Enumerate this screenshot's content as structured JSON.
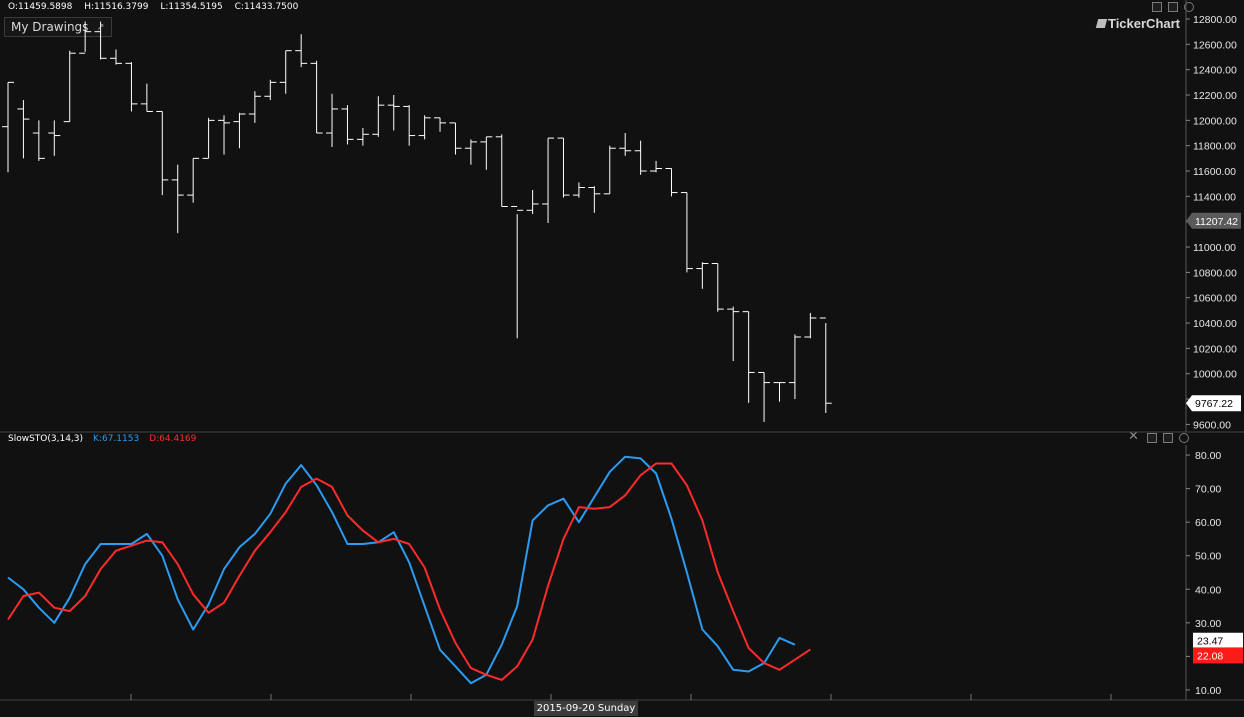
{
  "header": {
    "open": "O:11459.5898",
    "high": "H:11516.3799",
    "low": "L:11354.5195",
    "close": "C:11433.7500",
    "my_drawings": "My Drawings",
    "brand": "TickerChart"
  },
  "indicator_header": {
    "name": "SlowSTO(3,14,3)",
    "k": "K:67.1153",
    "d": "D:64.4169"
  },
  "date_tag": "2015-09-20 Sunday",
  "colors": {
    "background": "#111111",
    "bars": "#ffffff",
    "k_line": "#2b9cf2",
    "d_line": "#ff2b2b",
    "grid_divider": "#444444"
  },
  "chart_data": [
    {
      "type": "ohlc",
      "title": "",
      "price_axis_ticks": [
        "12800.00",
        "12600.00",
        "12400.00",
        "12200.00",
        "12000.00",
        "11800.00",
        "11600.00",
        "11400.00",
        "11200.00",
        "11000.00",
        "10800.00",
        "10600.00",
        "10400.00",
        "10200.00",
        "10000.00",
        "9800.00",
        "9600.00"
      ],
      "ylim": [
        9540,
        12950
      ],
      "last_price_tags": [
        {
          "label": "11207.42",
          "value": 11207.42,
          "style": "grey"
        },
        {
          "label": "9767.22",
          "value": 9767.22,
          "style": "white"
        }
      ],
      "bars": [
        {
          "o": 11950,
          "h": 12300,
          "l": 11590,
          "c": 12300
        },
        {
          "o": 12090,
          "h": 12160,
          "l": 11700,
          "c": 12010
        },
        {
          "o": 11900,
          "h": 12000,
          "l": 11680,
          "c": 11700
        },
        {
          "o": 11900,
          "h": 12000,
          "l": 11720,
          "c": 11880
        },
        {
          "o": 11990,
          "h": 12550,
          "l": 11990,
          "c": 12530
        },
        {
          "o": 12530,
          "h": 12780,
          "l": 12540,
          "c": 12700
        },
        {
          "o": 12700,
          "h": 12780,
          "l": 12480,
          "c": 12490
        },
        {
          "o": 12490,
          "h": 12560,
          "l": 12440,
          "c": 12450
        },
        {
          "o": 12450,
          "h": 12460,
          "l": 12070,
          "c": 12130
        },
        {
          "o": 12130,
          "h": 12290,
          "l": 12070,
          "c": 12070
        },
        {
          "o": 12070,
          "h": 12070,
          "l": 11410,
          "c": 11530
        },
        {
          "o": 11530,
          "h": 11650,
          "l": 11110,
          "c": 11410
        },
        {
          "o": 11410,
          "h": 11700,
          "l": 11350,
          "c": 11700
        },
        {
          "o": 11700,
          "h": 12020,
          "l": 11700,
          "c": 12000
        },
        {
          "o": 12000,
          "h": 12040,
          "l": 11730,
          "c": 11980
        },
        {
          "o": 11990,
          "h": 12060,
          "l": 11780,
          "c": 12050
        },
        {
          "o": 12050,
          "h": 12230,
          "l": 11980,
          "c": 12190
        },
        {
          "o": 12190,
          "h": 12320,
          "l": 12160,
          "c": 12300
        },
        {
          "o": 12300,
          "h": 12550,
          "l": 12210,
          "c": 12550
        },
        {
          "o": 12550,
          "h": 12680,
          "l": 12420,
          "c": 12450
        },
        {
          "o": 12450,
          "h": 12470,
          "l": 11900,
          "c": 11900
        },
        {
          "o": 11900,
          "h": 12210,
          "l": 11790,
          "c": 12090
        },
        {
          "o": 12090,
          "h": 12120,
          "l": 11810,
          "c": 11850
        },
        {
          "o": 11850,
          "h": 11940,
          "l": 11800,
          "c": 11890
        },
        {
          "o": 11890,
          "h": 12190,
          "l": 11870,
          "c": 12120
        },
        {
          "o": 12120,
          "h": 12200,
          "l": 11920,
          "c": 12110
        },
        {
          "o": 12110,
          "h": 12120,
          "l": 11800,
          "c": 11880
        },
        {
          "o": 11880,
          "h": 12040,
          "l": 11850,
          "c": 12020
        },
        {
          "o": 12020,
          "h": 12020,
          "l": 11910,
          "c": 11980
        },
        {
          "o": 11980,
          "h": 11980,
          "l": 11730,
          "c": 11780
        },
        {
          "o": 11780,
          "h": 11850,
          "l": 11650,
          "c": 11830
        },
        {
          "o": 11830,
          "h": 11870,
          "l": 11610,
          "c": 11870
        },
        {
          "o": 11870,
          "h": 11890,
          "l": 11320,
          "c": 11320
        },
        {
          "o": 11320,
          "h": 11260,
          "l": 10280,
          "c": 11290
        },
        {
          "o": 11290,
          "h": 11450,
          "l": 11260,
          "c": 11340
        },
        {
          "o": 11340,
          "h": 11860,
          "l": 11190,
          "c": 11860
        },
        {
          "o": 11860,
          "h": 11860,
          "l": 11390,
          "c": 11410
        },
        {
          "o": 11410,
          "h": 11510,
          "l": 11390,
          "c": 11470
        },
        {
          "o": 11470,
          "h": 11480,
          "l": 11270,
          "c": 11420
        },
        {
          "o": 11420,
          "h": 11800,
          "l": 11420,
          "c": 11780
        },
        {
          "o": 11780,
          "h": 11900,
          "l": 11720,
          "c": 11760
        },
        {
          "o": 11760,
          "h": 11840,
          "l": 11570,
          "c": 11600
        },
        {
          "o": 11600,
          "h": 11680,
          "l": 11590,
          "c": 11620
        },
        {
          "o": 11620,
          "h": 11620,
          "l": 11400,
          "c": 11430
        },
        {
          "o": 11430,
          "h": 11430,
          "l": 10800,
          "c": 10830
        },
        {
          "o": 10830,
          "h": 10880,
          "l": 10670,
          "c": 10870
        },
        {
          "o": 10870,
          "h": 10870,
          "l": 10490,
          "c": 10510
        },
        {
          "o": 10510,
          "h": 10530,
          "l": 10100,
          "c": 10490
        },
        {
          "o": 10490,
          "h": 10490,
          "l": 9770,
          "c": 10010
        },
        {
          "o": 10010,
          "h": 10010,
          "l": 9620,
          "c": 9930
        },
        {
          "o": 9930,
          "h": 9930,
          "l": 9780,
          "c": 9930
        },
        {
          "o": 9930,
          "h": 10310,
          "l": 9800,
          "c": 10290
        },
        {
          "o": 10290,
          "h": 10480,
          "l": 10280,
          "c": 10440
        },
        {
          "o": 10440,
          "h": 10400,
          "l": 9690,
          "c": 9767.22
        }
      ]
    },
    {
      "type": "line",
      "title": "SlowSTO(3,14,3)",
      "y_axis_ticks": [
        "80.00",
        "70.00",
        "60.00",
        "50.00",
        "40.00",
        "30.00",
        "20.00",
        "10.00"
      ],
      "ylim": [
        7,
        83
      ],
      "x_count": 54,
      "last_value_tags": [
        {
          "label": "23.47",
          "value": 23.47,
          "series": "K"
        },
        {
          "label": "22.08",
          "value": 22.08,
          "series": "D"
        }
      ],
      "series": [
        {
          "name": "K",
          "color": "#2b9cf2",
          "x_start": 0,
          "values": [
            43.5,
            40,
            34.5,
            30,
            37.5,
            47.5,
            53.5,
            53.5,
            53.5,
            56.5,
            50,
            37,
            28,
            35.5,
            46,
            52.5,
            56.5,
            62.5,
            71.5,
            77,
            71,
            63,
            53.5,
            53.5,
            54,
            57,
            48,
            35,
            22,
            17,
            12,
            14.5,
            23.5,
            35,
            60.5,
            65,
            67,
            60,
            67.5,
            75,
            79.5,
            79,
            74.5,
            61,
            45,
            28,
            23,
            16,
            15.5,
            18,
            25.5,
            23.47
          ]
        },
        {
          "name": "D",
          "color": "#ff2b2b",
          "x_start": 0,
          "values": [
            31,
            38,
            39,
            34.5,
            33.5,
            38,
            46,
            51.5,
            53,
            54.5,
            54,
            47.5,
            38.5,
            33,
            36,
            44,
            51.5,
            57,
            63,
            70.5,
            73,
            70.5,
            62,
            57.5,
            54,
            55,
            53.5,
            46.5,
            34,
            24,
            16.5,
            14.5,
            13,
            17,
            25,
            41,
            55,
            64.5,
            64,
            64.5,
            68,
            74,
            77.5,
            77.5,
            71,
            60.5,
            45,
            33.5,
            22.5,
            18,
            16,
            19,
            22.08
          ]
        }
      ]
    }
  ]
}
